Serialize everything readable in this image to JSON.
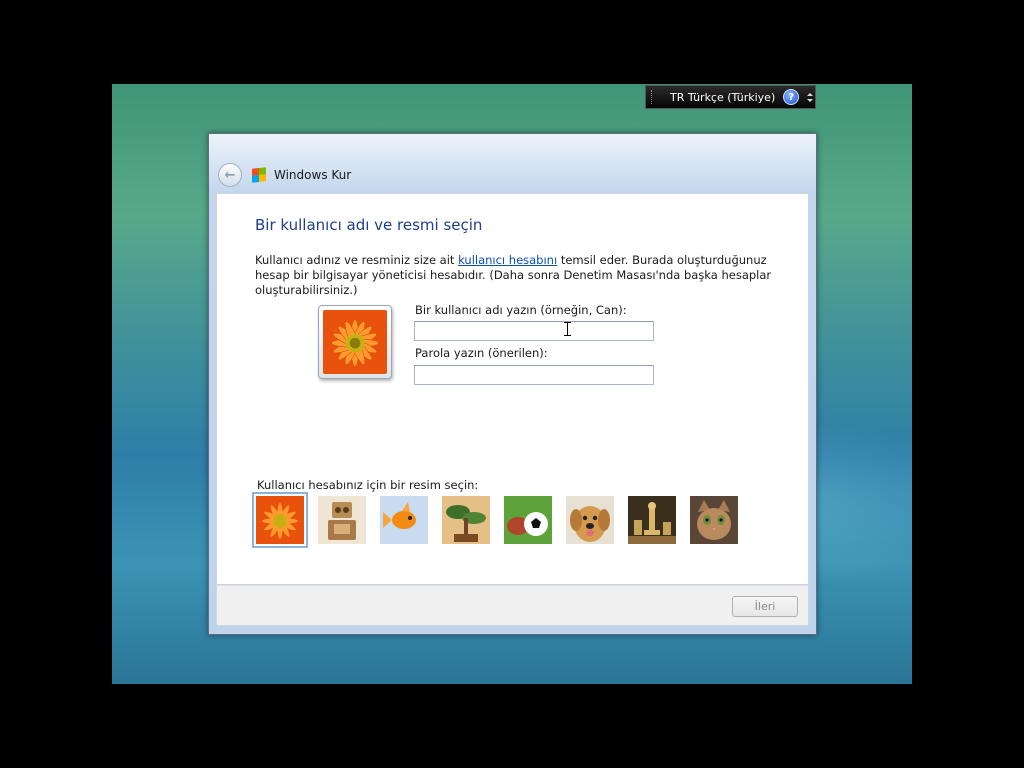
{
  "language_bar": {
    "label": "TR Türkçe (Türkiye)",
    "help_symbol": "?",
    "icons": [
      "help-icon",
      "options-icon"
    ]
  },
  "window": {
    "title": "Windows Kur",
    "icons": [
      "back-arrow-icon",
      "windows-logo-icon"
    ]
  },
  "page": {
    "heading": "Bir kullanıcı adı ve resmi seçin",
    "desc_before_link": "Kullanıcı adınız ve resminiz size ait ",
    "desc_link": "kullanıcı hesabını",
    "desc_after_link": " temsil eder. Burada oluşturduğunuz hesap bir bilgisayar yöneticisi hesabıdır. (Daha sonra Denetim Masası'nda başka hesaplar oluşturabilirsiniz.)"
  },
  "form": {
    "username_label": "Bir kullanıcı adı yazın (örneğin, Can):",
    "username_value": "",
    "password_label": "Parola yazın (önerilen):",
    "password_value": ""
  },
  "picture_picker": {
    "prompt": "Kullanıcı hesabınız için bir resim seçin:",
    "selected_index": 0,
    "pictures": [
      "flower",
      "robot",
      "fish",
      "bonsai",
      "soccer-ball",
      "dog",
      "chess",
      "kitten"
    ]
  },
  "buttons": {
    "next_label": "İleri",
    "next_enabled": false
  },
  "colors": {
    "heading": "#1e3f8c",
    "link": "#0b4fb3",
    "window_chrome": "#c4d6ec"
  }
}
